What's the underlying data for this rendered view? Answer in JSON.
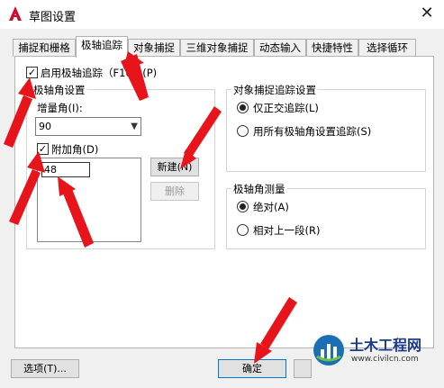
{
  "window": {
    "title": "草图设置",
    "close_glyph": "✕",
    "app_icon": "autocad-logo-icon"
  },
  "tabs": [
    {
      "label": "捕捉和栅格"
    },
    {
      "label": "极轴追踪",
      "active": true
    },
    {
      "label": "对象捕捉"
    },
    {
      "label": "三维对象捕捉"
    },
    {
      "label": "动态输入"
    },
    {
      "label": "快捷特性"
    },
    {
      "label": "选择循环"
    }
  ],
  "polar": {
    "enable_label": "启用极轴追踪（F10）(P)",
    "enabled": true,
    "angle_group_title": "极轴角设置",
    "increment_label": "增量角(I):",
    "increment_value": "90",
    "additional_label": "附加角(D)",
    "additional_checked": true,
    "additional_angles": [
      "48"
    ],
    "new_button": "新建(N)",
    "delete_button": "删除"
  },
  "snap_tracking": {
    "title": "对象捕捉追踪设置",
    "options": [
      {
        "label": "仅正交追踪(L)",
        "selected": true
      },
      {
        "label": "用所有极轴角设置追踪(S)",
        "selected": false
      }
    ]
  },
  "measure": {
    "title": "极轴角测量",
    "options": [
      {
        "label": "绝对(A)",
        "selected": true
      },
      {
        "label": "相对上一段(R)",
        "selected": false
      }
    ]
  },
  "footer": {
    "options_button": "选项(T)...",
    "ok_button": "确定"
  },
  "watermark": {
    "title": "土木工程网",
    "url": "www.civilcn.com"
  },
  "colors": {
    "annotation_arrow": "#e8141b",
    "app_icon": "#c8102e",
    "watermark_text": "#1a3a8a"
  }
}
